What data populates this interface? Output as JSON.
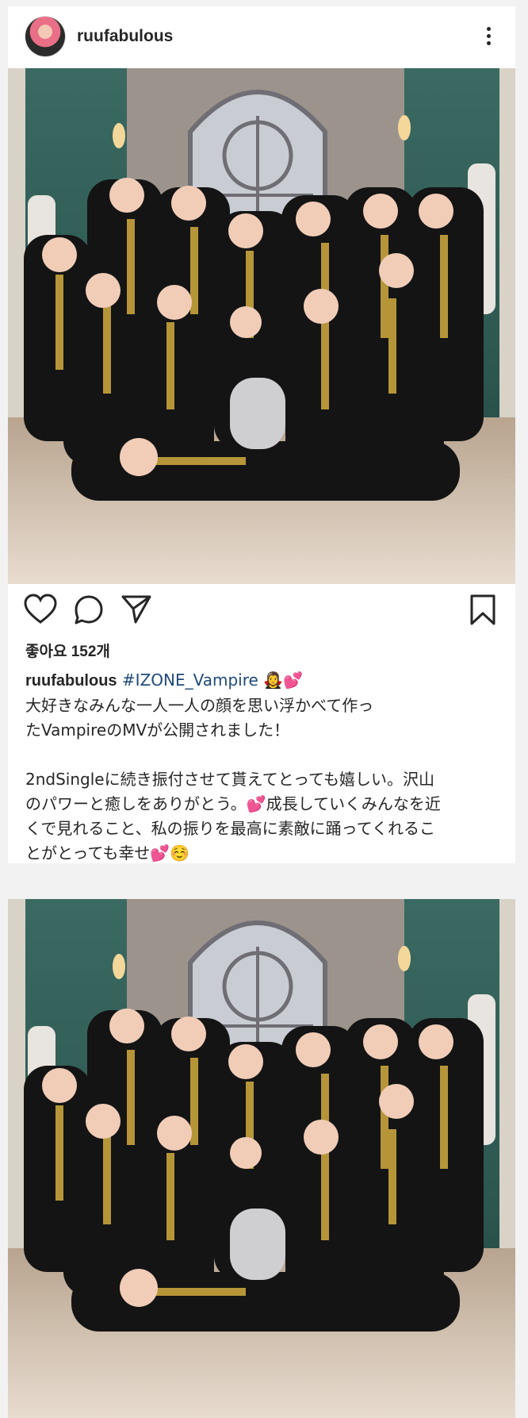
{
  "post1": {
    "username": "ruufabulous",
    "likes_text": "좋아요 152개",
    "caption": {
      "username": "ruufabulous",
      "hashtag": "#IZONE_Vampire",
      "emoji_after_tag": "🧛‍♀️💕",
      "line1": "大好きなみんな一人一人の顔を思い浮かべて作っ",
      "line2": "たVampireのMVが公開されました！",
      "p2_line1": "2ndSingleに続き振付させて貰えてとっても嬉しい。沢山",
      "p2_line2": "のパワーと癒しをありがとう。💕成長していくみんなを近",
      "p2_line3": "くで見れること、私の振りを最高に素敵に踊ってくれるこ",
      "p2_line4": "とがとっても幸せ💕☺️"
    }
  },
  "icons": [
    "more-options-icon",
    "heart-icon",
    "comment-icon",
    "share-icon",
    "bookmark-icon"
  ],
  "colors": {
    "background": "#f2f2f2",
    "card": "#ffffff",
    "text": "#262626",
    "hashtag": "#1f4a7a"
  }
}
